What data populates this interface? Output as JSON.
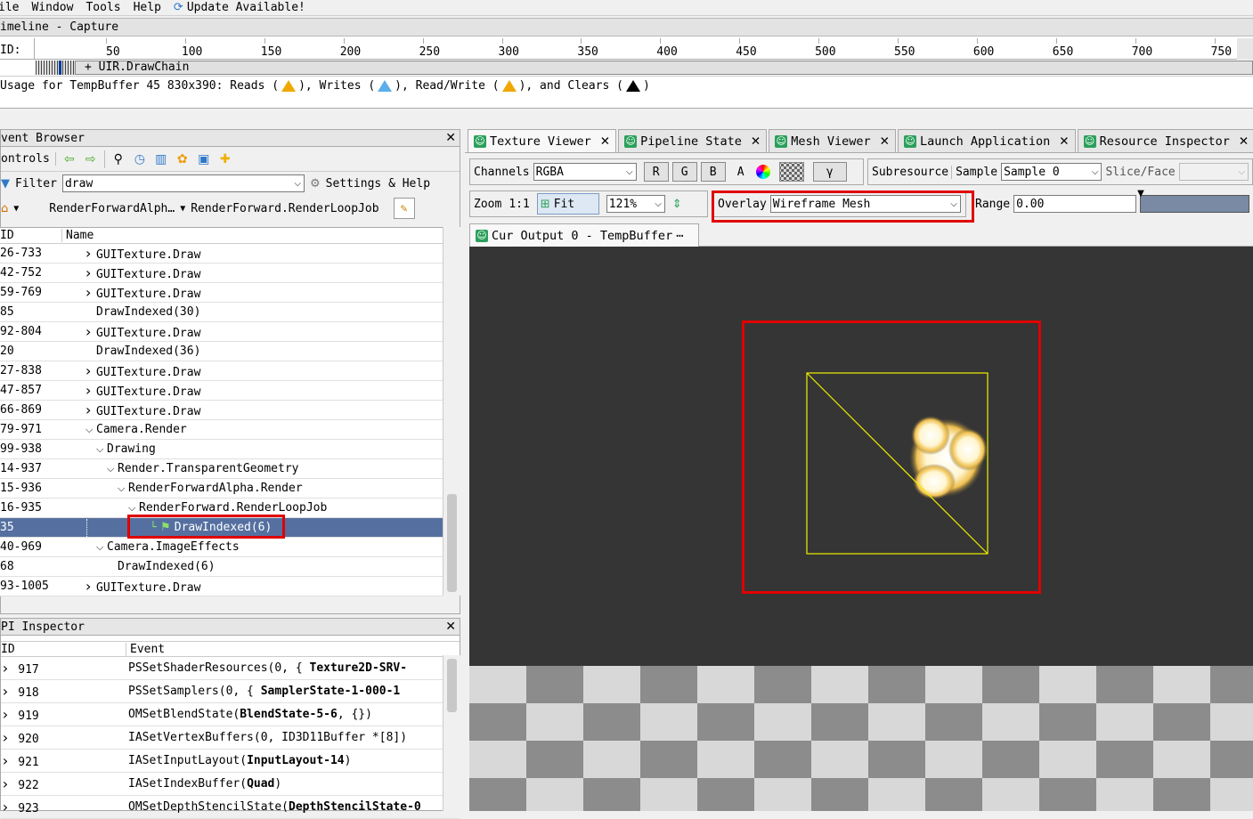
{
  "menu": {
    "items": [
      "ile",
      "Window",
      "Tools",
      "Help"
    ],
    "update": "Update Available!"
  },
  "timeline": {
    "title": "imeline - Capture",
    "eid_label": "ID:",
    "ticks": [
      "50",
      "100",
      "150",
      "200",
      "250",
      "300",
      "350",
      "400",
      "450",
      "500",
      "550",
      "600",
      "650",
      "700",
      "750"
    ],
    "marker_label": "+ UIR.DrawChain",
    "usage_prefix": "Usage for TempBuffer 45 830x390: Reads (",
    "usage_writes": "), Writes (",
    "usage_rw": "), Read/Write (",
    "usage_clears": "), and Clears (",
    "usage_end": ")"
  },
  "event_browser": {
    "title": "vent Browser",
    "controls_label": "ontrols",
    "filter_label": "Filter",
    "filter_value": "draw",
    "settings_label": "Settings & Help",
    "breadcrumb_1": "RenderForwardAlph…",
    "breadcrumb_2": "RenderForward.RenderLoopJob",
    "col_eid": "ID",
    "col_name": "Name",
    "rows": [
      {
        "eid": "26-733",
        "name": "GUITexture.Draw",
        "depth": 0,
        "chev": ">"
      },
      {
        "eid": "42-752",
        "name": "GUITexture.Draw",
        "depth": 0,
        "chev": ">"
      },
      {
        "eid": "59-769",
        "name": "GUITexture.Draw",
        "depth": 0,
        "chev": ">"
      },
      {
        "eid": "85",
        "name": "DrawIndexed(30)",
        "depth": 0,
        "chev": ""
      },
      {
        "eid": "92-804",
        "name": "GUITexture.Draw",
        "depth": 0,
        "chev": ">"
      },
      {
        "eid": "20",
        "name": "DrawIndexed(36)",
        "depth": 0,
        "chev": ""
      },
      {
        "eid": "27-838",
        "name": "GUITexture.Draw",
        "depth": 0,
        "chev": ">"
      },
      {
        "eid": "47-857",
        "name": "GUITexture.Draw",
        "depth": 0,
        "chev": ">"
      },
      {
        "eid": "66-869",
        "name": "GUITexture.Draw",
        "depth": 0,
        "chev": ">"
      },
      {
        "eid": "79-971",
        "name": "Camera.Render",
        "depth": 0,
        "chev": "v"
      },
      {
        "eid": "99-938",
        "name": "Drawing",
        "depth": 1,
        "chev": "v"
      },
      {
        "eid": "14-937",
        "name": "Render.TransparentGeometry",
        "depth": 2,
        "chev": "v"
      },
      {
        "eid": "15-936",
        "name": "RenderForwardAlpha.Render",
        "depth": 3,
        "chev": "v"
      },
      {
        "eid": "16-935",
        "name": "RenderForward.RenderLoopJob",
        "depth": 4,
        "chev": "v"
      },
      {
        "eid": "35",
        "name": "DrawIndexed(6)",
        "depth": 5,
        "chev": "",
        "selected": true
      },
      {
        "eid": "40-969",
        "name": "Camera.ImageEffects",
        "depth": 1,
        "chev": "v"
      },
      {
        "eid": "68",
        "name": "DrawIndexed(6)",
        "depth": 2,
        "chev": ""
      },
      {
        "eid": "93-1005",
        "name": "GUITexture.Draw",
        "depth": 0,
        "chev": ">"
      }
    ]
  },
  "api_inspector": {
    "title": "PI Inspector",
    "col_eid": "ID",
    "col_event": "Event",
    "rows": [
      {
        "eid": "917",
        "event": "PSSetShaderResources(0,  {  ",
        "bold": "Texture2D-SRV-"
      },
      {
        "eid": "918",
        "event": "PSSetSamplers(0,  {  ",
        "bold": "SamplerState-1-000-1"
      },
      {
        "eid": "919",
        "event": "OMSetBlendState(",
        "bold": "BlendState-5-6",
        "tail": ",  {})"
      },
      {
        "eid": "920",
        "event": "IASetVertexBuffers(0,  ID3D11Buffer *[8])",
        "bold": ""
      },
      {
        "eid": "921",
        "event": "IASetInputLayout(",
        "bold": "InputLayout-14",
        "tail": ")"
      },
      {
        "eid": "922",
        "event": "IASetIndexBuffer(",
        "bold": "Quad",
        "tail": ")"
      },
      {
        "eid": "923",
        "event": "OMSetDepthStencilState(",
        "bold": "DepthStencilState-0"
      }
    ]
  },
  "tabs": [
    {
      "label": "Texture Viewer",
      "active": true
    },
    {
      "label": "Pipeline State"
    },
    {
      "label": "Mesh Viewer"
    },
    {
      "label": "Launch Application"
    },
    {
      "label": "Resource Inspector"
    }
  ],
  "texture_viewer": {
    "channels_label": "Channels",
    "channels_value": "RGBA",
    "btn_r": "R",
    "btn_g": "G",
    "btn_b": "B",
    "btn_a": "A",
    "btn_gamma": "γ",
    "subresource_label": "Subresource",
    "sample_label": "Sample",
    "sample_value": "Sample 0",
    "slice_label": "Slice/Face",
    "zoom_label": "Zoom",
    "zoom_11": "1:1",
    "fit_label": "Fit",
    "zoom_value": "121%",
    "overlay_label": "Overlay",
    "overlay_value": "Wireframe Mesh",
    "range_label": "Range",
    "range_value": "0.00",
    "output_tab": "Cur Output 0 - TempBuffer"
  },
  "colors": {
    "selection": "#5570a0",
    "highlight": "#e00000",
    "wireframe": "#f0f000",
    "viewport": "#353535"
  }
}
